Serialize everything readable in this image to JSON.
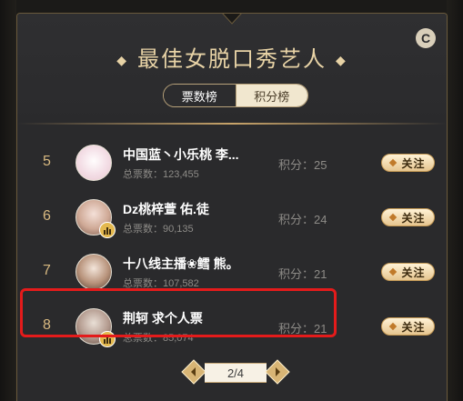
{
  "header": {
    "title": "最佳女脱口秀艺人",
    "refresh_icon_text": "C"
  },
  "tabs": [
    {
      "label": "票数榜",
      "active": true
    },
    {
      "label": "积分榜",
      "active": false
    }
  ],
  "rows": [
    {
      "rank": "5",
      "name": "中国蓝丶小乐桃 李...",
      "votes": "总票数：123,455",
      "score": "积分：25",
      "follow": "关注",
      "live": false
    },
    {
      "rank": "6",
      "name": "Dz桃梓萱 佑.徒",
      "votes": "总票数：90,135",
      "score": "积分：24",
      "follow": "关注",
      "live": true
    },
    {
      "rank": "7",
      "name": "十八线主播❀鳕 熊。",
      "votes": "总票数：107,582",
      "score": "积分：21",
      "follow": "关注",
      "live": false
    },
    {
      "rank": "8",
      "name": "荆轲 求个人票",
      "votes": "总票数：85,074",
      "score": "积分：21",
      "follow": "关注",
      "live": true
    }
  ],
  "pagination": {
    "label": "2/4"
  },
  "colors": {
    "gold": "#e8d3a6",
    "highlight": "#e41b1b",
    "panel": "#2a2a2c"
  }
}
